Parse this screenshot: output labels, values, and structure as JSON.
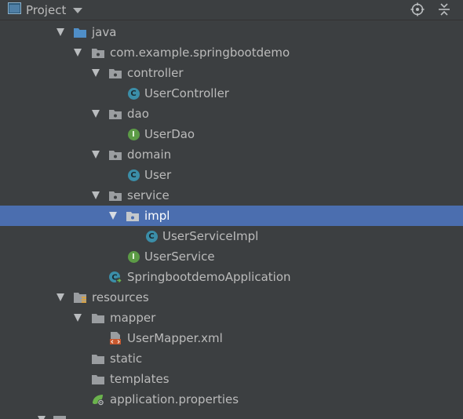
{
  "header": {
    "title": "Project"
  },
  "tree": [
    {
      "label": "java",
      "type": "source-folder",
      "expanded": true,
      "icon": "source-folder-icon"
    },
    {
      "label": "com.example.springbootdemo",
      "type": "package",
      "expanded": true,
      "icon": "package-icon"
    },
    {
      "label": "controller",
      "type": "package",
      "expanded": true,
      "icon": "package-icon"
    },
    {
      "label": "UserController",
      "type": "class",
      "icon": "class-icon",
      "badge": "C"
    },
    {
      "label": "dao",
      "type": "package",
      "expanded": true,
      "icon": "package-icon"
    },
    {
      "label": "UserDao",
      "type": "interface",
      "icon": "interface-icon",
      "badge": "I"
    },
    {
      "label": "domain",
      "type": "package",
      "expanded": true,
      "icon": "package-icon"
    },
    {
      "label": "User",
      "type": "class",
      "icon": "class-icon",
      "badge": "C"
    },
    {
      "label": "service",
      "type": "package",
      "expanded": true,
      "icon": "package-icon"
    },
    {
      "label": "impl",
      "type": "package",
      "expanded": true,
      "selected": true,
      "icon": "package-icon"
    },
    {
      "label": "UserServiceImpl",
      "type": "class",
      "icon": "class-icon",
      "badge": "C"
    },
    {
      "label": "UserService",
      "type": "interface",
      "icon": "interface-icon",
      "badge": "I"
    },
    {
      "label": "SpringbootdemoApplication",
      "type": "spring-boot-class",
      "icon": "spring-boot-class-icon"
    },
    {
      "label": "resources",
      "type": "resources-folder",
      "expanded": true,
      "icon": "resources-folder-icon"
    },
    {
      "label": "mapper",
      "type": "folder",
      "expanded": true,
      "icon": "folder-icon"
    },
    {
      "label": "UserMapper.xml",
      "type": "xml",
      "icon": "xml-file-icon"
    },
    {
      "label": "static",
      "type": "folder",
      "icon": "folder-icon"
    },
    {
      "label": "templates",
      "type": "folder",
      "icon": "folder-icon"
    },
    {
      "label": "application.properties",
      "type": "properties",
      "icon": "spring-properties-icon"
    }
  ],
  "colors": {
    "background": "#3c3f41",
    "selection": "#4b6eaf",
    "text": "#bbbbbb",
    "class_badge": "#3b8ea8",
    "interface_badge": "#5c9b46"
  }
}
